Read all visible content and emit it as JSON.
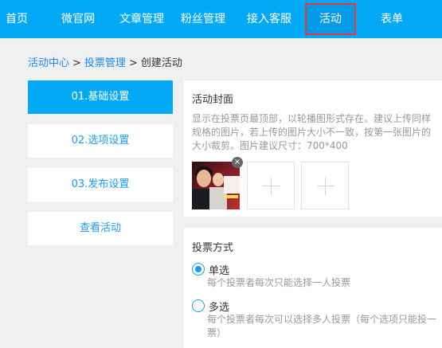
{
  "nav": {
    "items": [
      {
        "label": "首页"
      },
      {
        "label": "微官网"
      },
      {
        "label": "文章管理"
      },
      {
        "label": "粉丝管理"
      },
      {
        "label": "接入客服"
      },
      {
        "label": "活动"
      },
      {
        "label": "表单"
      }
    ],
    "active_index": 5
  },
  "breadcrumb": {
    "level1": "活动中心",
    "level2": "投票管理",
    "current": "创建活动",
    "separator": ">"
  },
  "steps": [
    {
      "label": "01.基础设置"
    },
    {
      "label": "02.选项设置"
    },
    {
      "label": "03.发布设置"
    },
    {
      "label": "查看活动"
    }
  ],
  "cover": {
    "title": "活动封面",
    "description": "显示在投票页最顶部，以轮播图形式存在。建议上传同样规格的图片，若上传的图片大小不一致，按第一张图片的大小裁剪。图片建议尺寸：700*400",
    "delete_symbol": "×"
  },
  "vote_mode": {
    "title": "投票方式",
    "selected": "single",
    "options": [
      {
        "label": "单选",
        "desc": "每个投票者每次只能选择一人投票"
      },
      {
        "label": "多选",
        "desc": "每个投票者每次可以选择多人投票（每个选项只能投一票）"
      }
    ]
  },
  "colors": {
    "nav_bg": "#03a9f4",
    "active_outline": "#e5393d",
    "link": "#1e88e5"
  }
}
